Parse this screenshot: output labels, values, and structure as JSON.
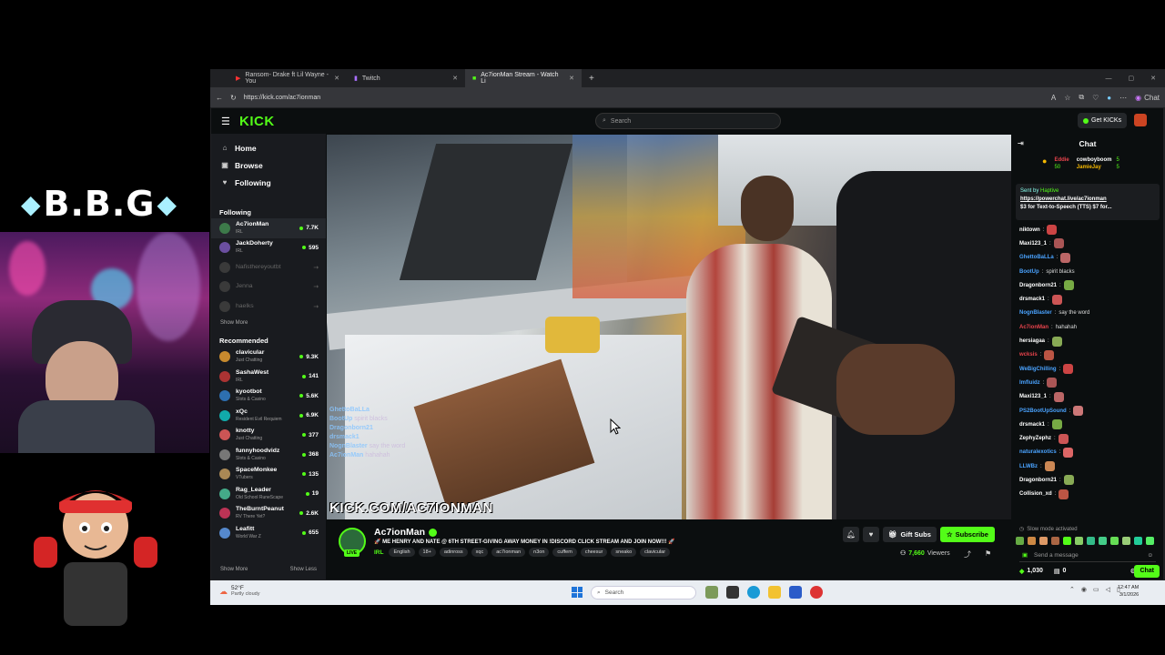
{
  "overlay": {
    "title": "B.B.G"
  },
  "browser": {
    "tabs": [
      {
        "label": "Ransom- Drake ft Lil Wayne - You"
      },
      {
        "label": "Twitch"
      },
      {
        "label": "Ac7ionMan Stream - Watch Li"
      }
    ],
    "url": "https://kick.com/ac7ionman",
    "chat_btn": "Chat"
  },
  "kick": {
    "search_placeholder": "Search",
    "get_kicks": "Get KICKs",
    "nav": [
      {
        "label": "Home",
        "icon": "home-icon"
      },
      {
        "label": "Browse",
        "icon": "browse-icon"
      },
      {
        "label": "Following",
        "icon": "heart-icon"
      }
    ],
    "following_header": "Following",
    "following": [
      {
        "name": "Ac7ionMan",
        "category": "IRL",
        "viewers": "7.7K",
        "live": true
      },
      {
        "name": "JackDoherty",
        "category": "IRL",
        "viewers": "595",
        "live": true
      },
      {
        "name": "Nafisthereyoutbt",
        "category": "",
        "viewers": "",
        "live": false
      },
      {
        "name": "Jenna",
        "category": "",
        "viewers": "",
        "live": false
      },
      {
        "name": "haelks",
        "category": "",
        "viewers": "",
        "live": false
      }
    ],
    "show_more": "Show More",
    "recommended_header": "Recommended",
    "recommended": [
      {
        "name": "clavicular",
        "category": "Just Chatting",
        "viewers": "9.3K"
      },
      {
        "name": "SashaWest",
        "category": "IRL",
        "viewers": "141"
      },
      {
        "name": "kyootbot",
        "category": "Slots & Casino",
        "viewers": "5.6K"
      },
      {
        "name": "xQc",
        "category": "Resident Evil Requiem",
        "viewers": "6.9K"
      },
      {
        "name": "knotty",
        "category": "Just Chatting",
        "viewers": "377"
      },
      {
        "name": "funnyhoodvidz",
        "category": "Slots & Casino",
        "viewers": "368"
      },
      {
        "name": "SpaceMonkee",
        "category": "VTubers",
        "viewers": "135"
      },
      {
        "name": "Rag_Leader",
        "category": "Old School RuneScape",
        "viewers": "19"
      },
      {
        "name": "TheBurntPeanut",
        "category": "RV There Yet?",
        "viewers": "2.6K"
      },
      {
        "name": "Leafitt",
        "category": "World War Z",
        "viewers": "655"
      }
    ],
    "show_more_bottom": "Show More",
    "show_less": "Show Less",
    "video": {
      "watermark": "KICK.COM/AC7IONMAN",
      "overlay_chat": [
        {
          "user": "GhettoBaLLa",
          "text": ""
        },
        {
          "user": "BootUp",
          "text": "spirit blacks"
        },
        {
          "user": "Dragonborn21",
          "text": ""
        },
        {
          "user": "drsmack1",
          "text": ""
        },
        {
          "user": "NognBlaster",
          "text": "say the word"
        },
        {
          "user": "Ac7ionMan",
          "text": "hahahah"
        }
      ]
    },
    "stream": {
      "channel": "Ac7ionMan",
      "live_label": "LIVE",
      "title": "🚀 ME HENRY AND NATE @ 6TH STREET-GIVING AWAY MONEY IN !DISCORD CLICK STREAM AND JOIN NOW!!! 🚀",
      "category": "IRL",
      "tags": [
        "English",
        "18+",
        "adinross",
        "xqc",
        "ac7ionman",
        "n3on",
        "cuffem",
        "cheesur",
        "sneako",
        "clavicular"
      ],
      "gift_subs": "Gift Subs",
      "subscribe": "Subscribe",
      "viewers_count": "7,660",
      "viewers_label": "Viewers"
    },
    "chat": {
      "title": "Chat",
      "gifters": [
        {
          "name": "Eddie",
          "count": "50"
        },
        {
          "name": "cowboyboom",
          "count": "5"
        },
        {
          "name": "JamieJay",
          "count": "5"
        }
      ],
      "pinned": {
        "sent_by": "Sent by",
        "sender": "Haptive",
        "link": "https://powerchat.live/ac7ionman",
        "text": "$3 for Text-to-Speech (TTS) $7 for..."
      },
      "messages": [
        {
          "user": "niktown",
          "text": "",
          "color": "#ffffff"
        },
        {
          "user": "Maxi123_1",
          "text": "",
          "color": "#ffffff"
        },
        {
          "user": "GhettoBaLLa",
          "text": "",
          "color": "#4aa3ff"
        },
        {
          "user": "BootUp",
          "text": "spirit blacks",
          "color": "#4aa3ff"
        },
        {
          "user": "Dragonborn21",
          "text": "",
          "color": "#ffffff"
        },
        {
          "user": "drsmack1",
          "text": "",
          "color": "#ffffff"
        },
        {
          "user": "NognBlaster",
          "text": "say the word",
          "color": "#4aa3ff"
        },
        {
          "user": "Ac7ionMan",
          "text": "hahahah",
          "color": "#e8434c"
        },
        {
          "user": "hersiagaa",
          "text": "",
          "color": "#ffffff"
        },
        {
          "user": "wcksis",
          "text": "",
          "color": "#e8434c"
        },
        {
          "user": "WeBigChilling",
          "text": "",
          "color": "#4aa3ff"
        },
        {
          "user": "Imfluidz",
          "text": "",
          "color": "#4aa3ff"
        },
        {
          "user": "Maxi123_1",
          "text": "",
          "color": "#ffffff"
        },
        {
          "user": "PS2BootUpSound",
          "text": "",
          "color": "#4aa3ff"
        },
        {
          "user": "drsmack1",
          "text": "",
          "color": "#ffffff"
        },
        {
          "user": "ZephyZephz",
          "text": "",
          "color": "#ffffff"
        },
        {
          "user": "naturalexotics",
          "text": "",
          "color": "#4aa3ff"
        },
        {
          "user": "LLWBz",
          "text": "",
          "color": "#4aa3ff"
        },
        {
          "user": "Dragonborn21",
          "text": "",
          "color": "#ffffff"
        },
        {
          "user": "Collision_xd",
          "text": "",
          "color": "#ffffff"
        }
      ],
      "slow_mode": "Slow mode activated",
      "send_placeholder": "Send a message",
      "kicks_balance": "1,030",
      "points": "0",
      "chat_button": "Chat"
    }
  },
  "taskbar": {
    "temp": "52°F",
    "weather": "Partly cloudy",
    "search": "Search",
    "time": "12:47 AM",
    "date": "3/1/2026"
  }
}
